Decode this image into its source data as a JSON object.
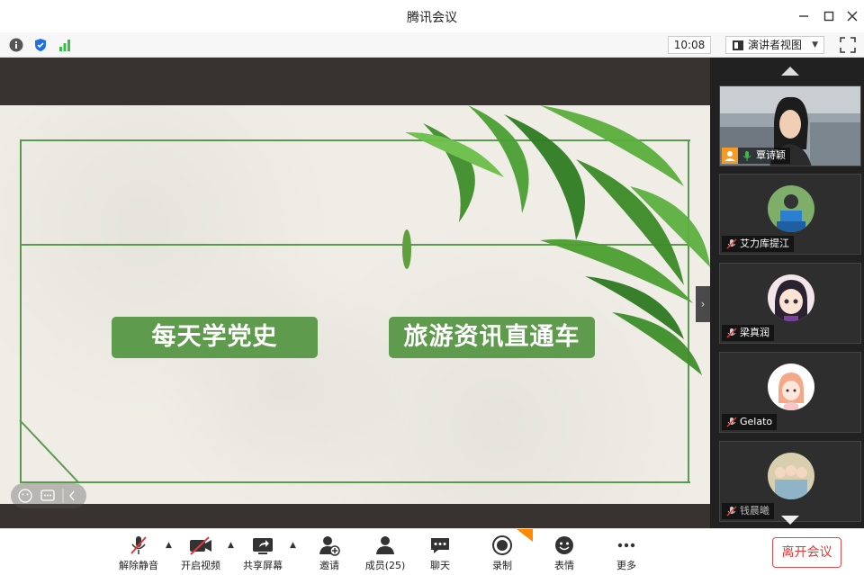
{
  "window": {
    "title": "腾讯会议"
  },
  "toolbar": {
    "time": "10:08",
    "view_mode": "演讲者视图"
  },
  "slide": {
    "button_left": "每天学党史",
    "button_right": "旅游资讯直通车"
  },
  "participants": [
    {
      "name": "覃诗颖",
      "video": true
    },
    {
      "name": "艾力库提江",
      "video": false
    },
    {
      "name": "梁真润",
      "video": false
    },
    {
      "name": "Gelato",
      "video": false
    },
    {
      "name": "钱晨曦",
      "video": false
    }
  ],
  "bottom": {
    "unmute": "解除静音",
    "video": "开启视频",
    "share": "共享屏幕",
    "invite": "邀请",
    "members": "成员(25)",
    "chat": "聊天",
    "record": "录制",
    "reactions": "表情",
    "more": "更多",
    "leave": "离开会议"
  },
  "colors": {
    "slide_green": "#5e9b4c",
    "leave_red": "#e03a3a",
    "panel_bg": "#212121"
  }
}
